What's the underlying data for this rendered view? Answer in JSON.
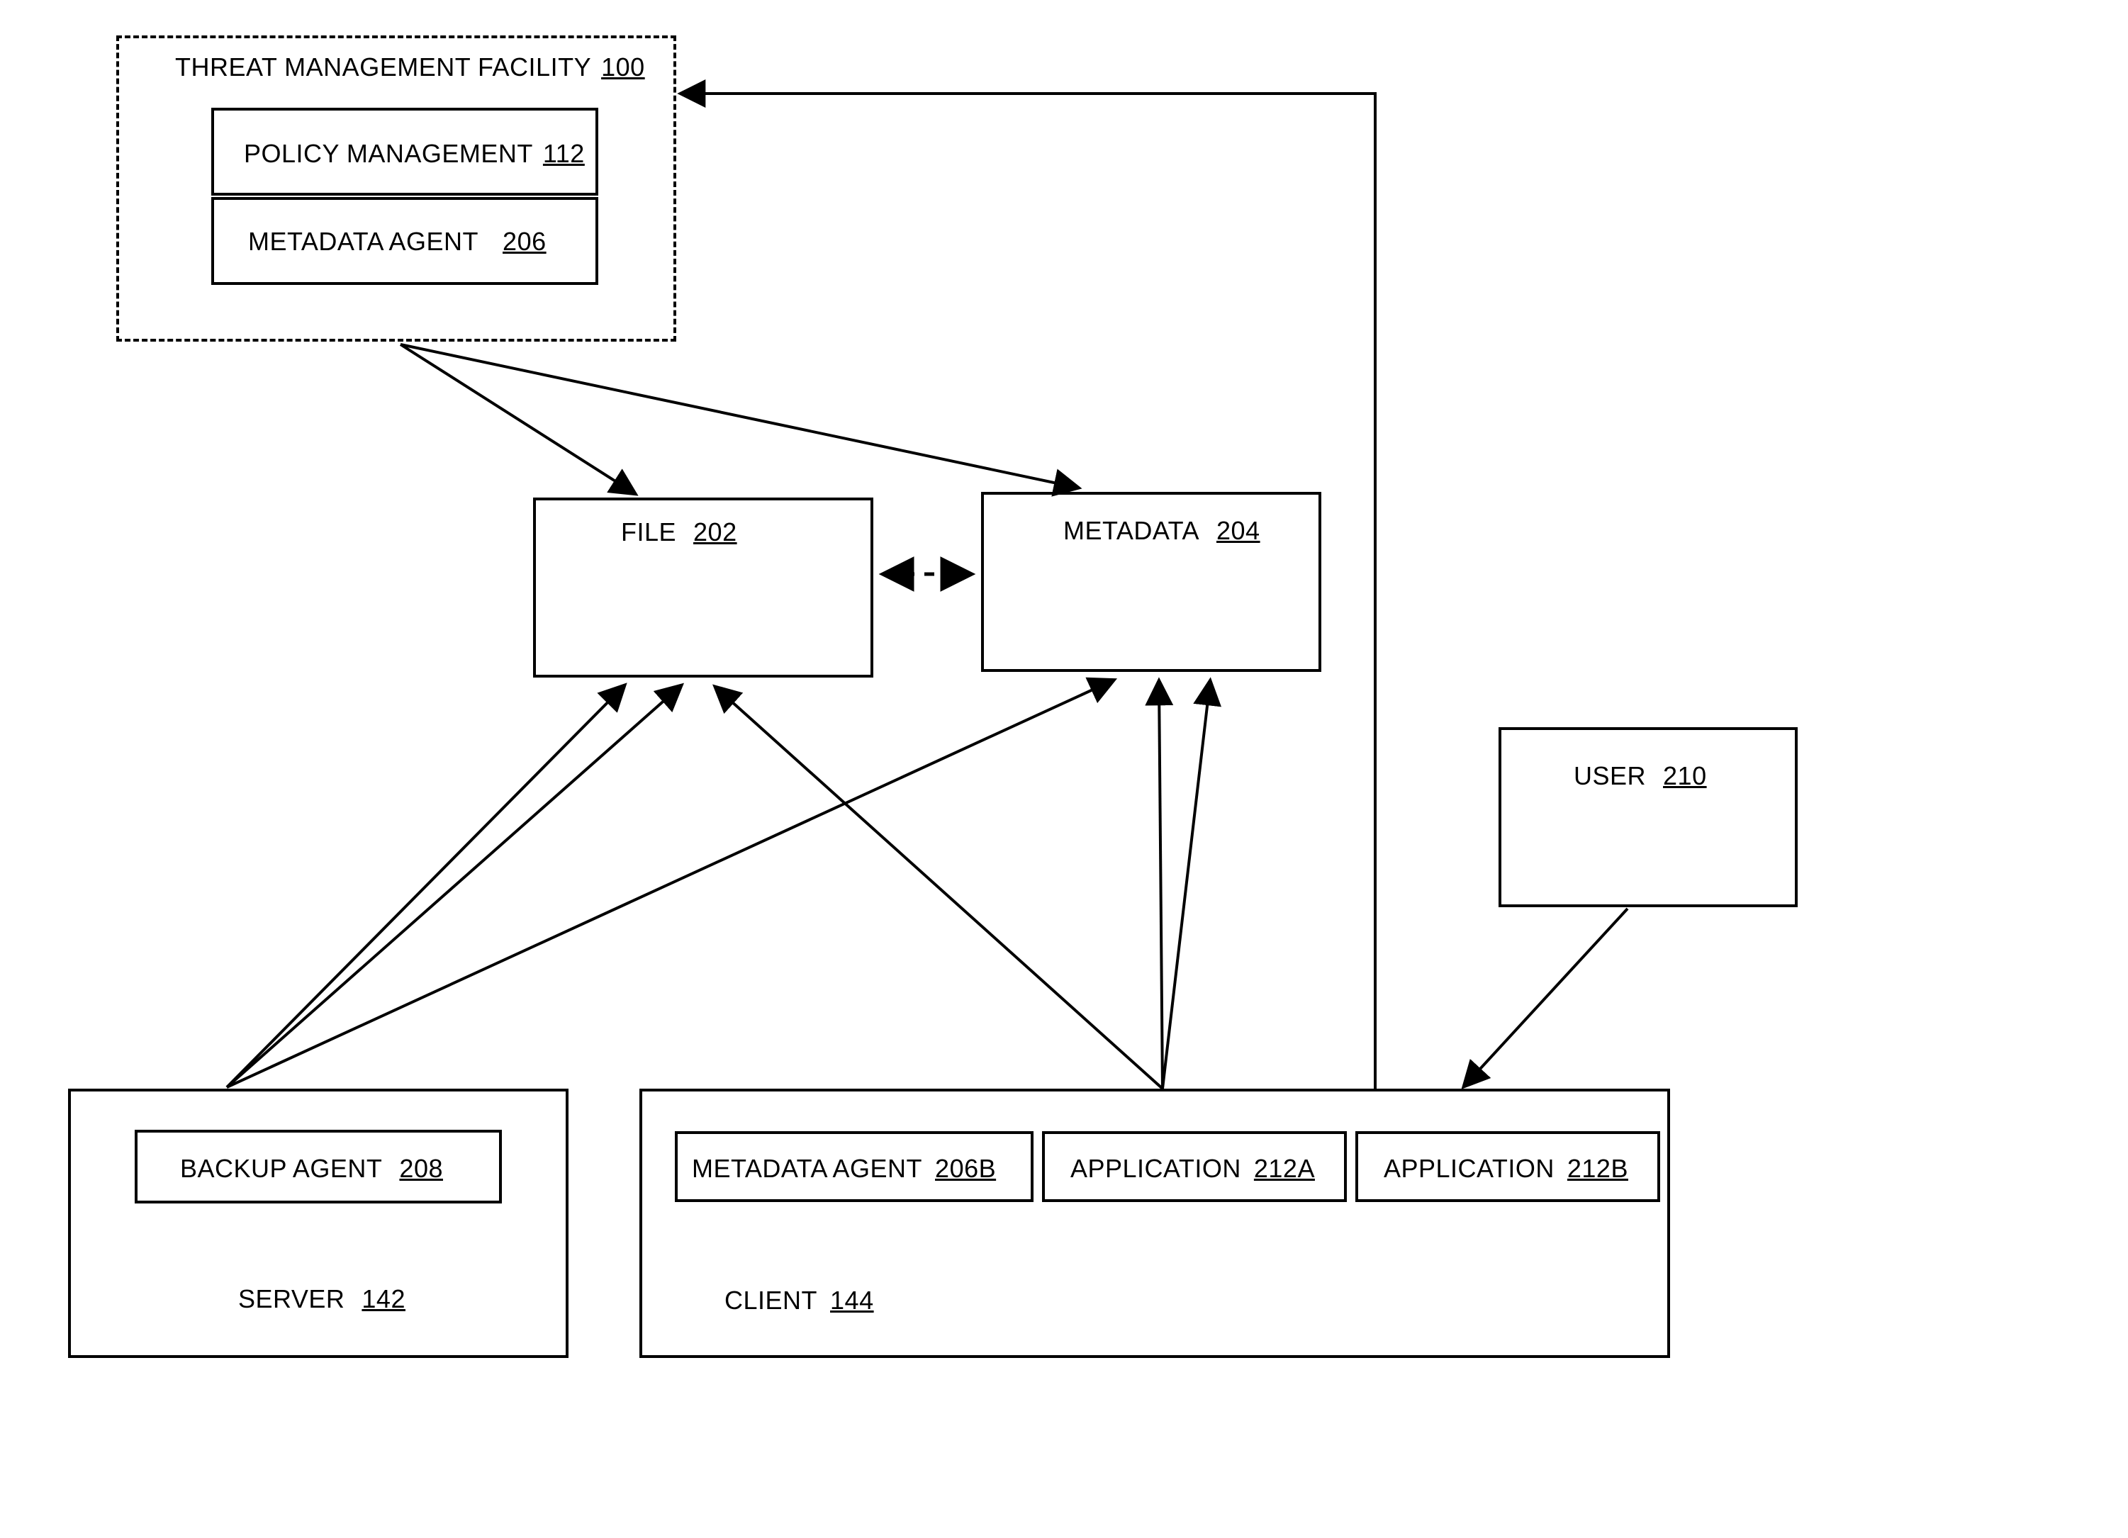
{
  "tmf": {
    "title": "THREAT MANAGEMENT FACILITY",
    "ref": "100"
  },
  "policy": {
    "title": "POLICY  MANAGEMENT",
    "ref": "112"
  },
  "meta_agent": {
    "title": "METADATA AGENT",
    "ref": "206"
  },
  "file": {
    "title": "FILE",
    "ref": "202"
  },
  "metadata": {
    "title": "METADATA",
    "ref": "204"
  },
  "user": {
    "title": "USER",
    "ref": "210"
  },
  "server": {
    "title": "SERVER",
    "ref": "142"
  },
  "backup": {
    "title": "BACKUP AGENT",
    "ref": "208"
  },
  "client": {
    "title": "CLIENT",
    "ref": "144"
  },
  "meta_agent_b": {
    "title": "METADATA AGENT",
    "ref": "206B"
  },
  "app_a": {
    "title": "APPLICATION",
    "ref": "212A"
  },
  "app_b": {
    "title": "APPLICATION",
    "ref": "212B"
  }
}
